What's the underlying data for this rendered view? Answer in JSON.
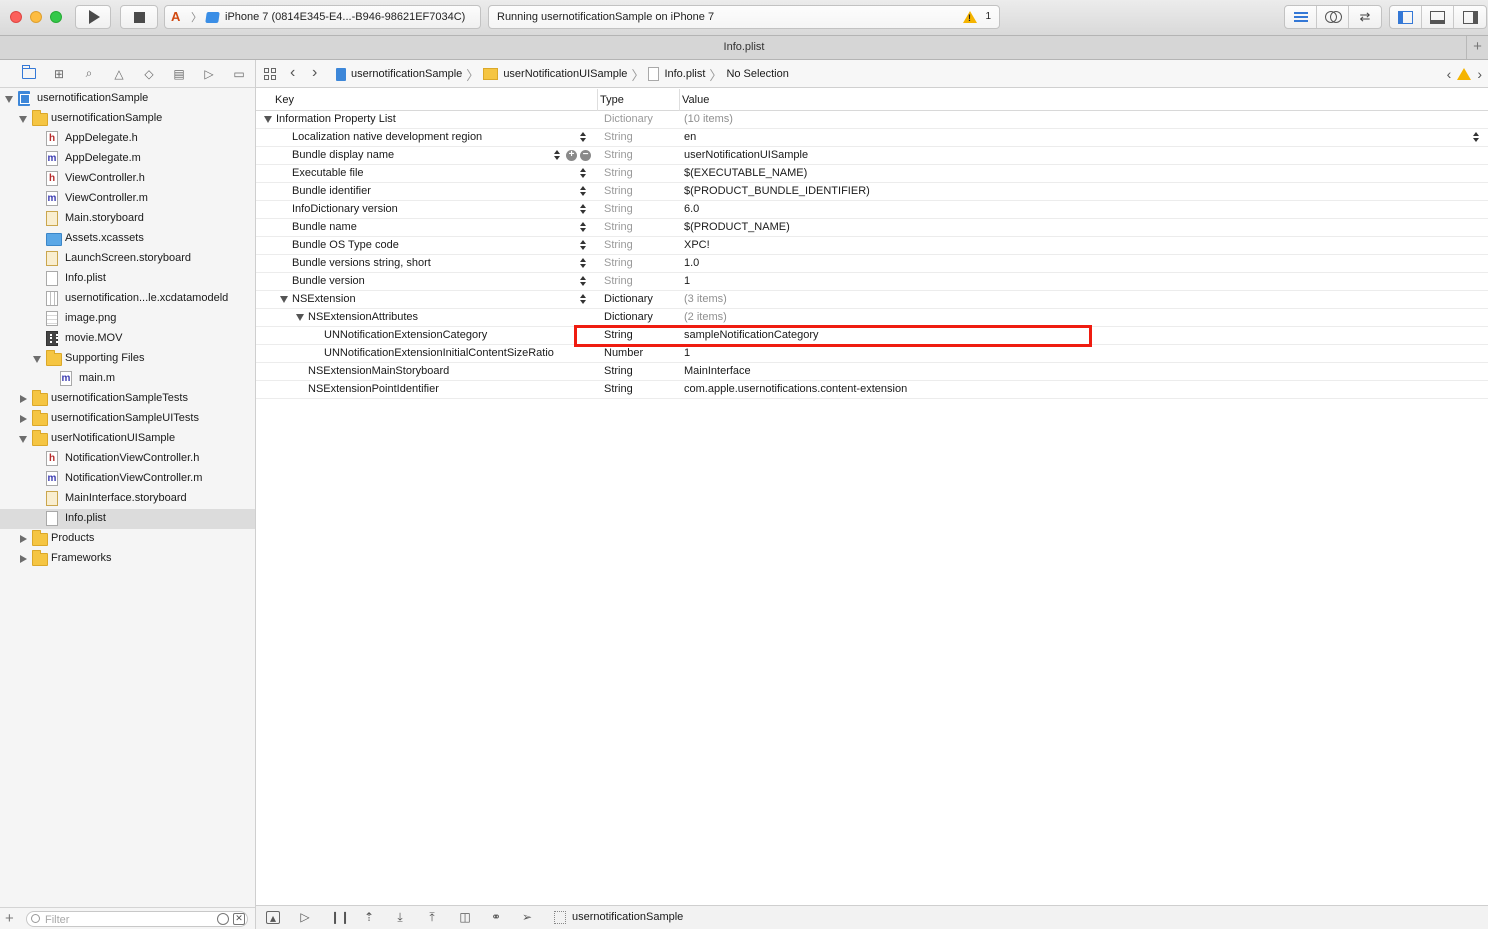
{
  "toolbar": {
    "scheme": "iPhone 7 (0814E345-E4...-B946-98621EF7034C)",
    "activity": "Running usernotificationSample on iPhone 7",
    "warning_count": "1"
  },
  "tab": {
    "title": "Info.plist"
  },
  "navigator": {
    "items": [
      {
        "label": "usernotificationSample",
        "icon": "project-icon",
        "state": "open"
      },
      {
        "label": "usernotificationSample",
        "icon": "folder-icon",
        "state": "open"
      },
      {
        "label": "AppDelegate.h",
        "icon": "header-file-icon",
        "glyph": "h"
      },
      {
        "label": "AppDelegate.m",
        "icon": "objc-file-icon",
        "glyph": "m"
      },
      {
        "label": "ViewController.h",
        "icon": "header-file-icon",
        "glyph": "h"
      },
      {
        "label": "ViewController.m",
        "icon": "objc-file-icon",
        "glyph": "m"
      },
      {
        "label": "Main.storyboard",
        "icon": "storyboard-file-icon"
      },
      {
        "label": "Assets.xcassets",
        "icon": "asset-catalog-icon"
      },
      {
        "label": "LaunchScreen.storyboard",
        "icon": "storyboard-file-icon"
      },
      {
        "label": "Info.plist",
        "icon": "plist-file-icon"
      },
      {
        "label": "usernotification...le.xcdatamodeld",
        "icon": "core-data-model-icon"
      },
      {
        "label": "image.png",
        "icon": "image-file-icon"
      },
      {
        "label": "movie.MOV",
        "icon": "movie-file-icon"
      },
      {
        "label": "Supporting Files",
        "icon": "folder-icon",
        "state": "open"
      },
      {
        "label": "main.m",
        "icon": "objc-file-icon",
        "glyph": "m"
      },
      {
        "label": "usernotificationSampleTests",
        "icon": "folder-icon",
        "state": "closed"
      },
      {
        "label": "usernotificationSampleUITests",
        "icon": "folder-icon",
        "state": "closed"
      },
      {
        "label": "userNotificationUISample",
        "icon": "folder-icon",
        "state": "open"
      },
      {
        "label": "NotificationViewController.h",
        "icon": "header-file-icon",
        "glyph": "h"
      },
      {
        "label": "NotificationViewController.m",
        "icon": "objc-file-icon",
        "glyph": "m"
      },
      {
        "label": "MainInterface.storyboard",
        "icon": "storyboard-file-icon"
      },
      {
        "label": "Info.plist",
        "icon": "plist-file-icon",
        "selected": true
      },
      {
        "label": "Products",
        "icon": "folder-icon",
        "state": "closed"
      },
      {
        "label": "Frameworks",
        "icon": "folder-icon",
        "state": "closed"
      }
    ],
    "filter_placeholder": "Filter"
  },
  "jumpbar": {
    "crumbs": [
      "usernotificationSample",
      "userNotificationUISample",
      "Info.plist",
      "No Selection"
    ]
  },
  "plist": {
    "columns": {
      "key": "Key",
      "type": "Type",
      "value": "Value"
    },
    "rows": [
      {
        "key": "Information Property List",
        "type": "Dictionary",
        "value": "(10 items)",
        "disclosure": true
      },
      {
        "key": "Localization native development region",
        "type": "String",
        "value": "en"
      },
      {
        "key": "Bundle display name",
        "type": "String",
        "value": "userNotificationUISample"
      },
      {
        "key": "Executable file",
        "type": "String",
        "value": "$(EXECUTABLE_NAME)"
      },
      {
        "key": "Bundle identifier",
        "type": "String",
        "value": "$(PRODUCT_BUNDLE_IDENTIFIER)"
      },
      {
        "key": "InfoDictionary version",
        "type": "String",
        "value": "6.0"
      },
      {
        "key": "Bundle name",
        "type": "String",
        "value": "$(PRODUCT_NAME)"
      },
      {
        "key": "Bundle OS Type code",
        "type": "String",
        "value": "XPC!"
      },
      {
        "key": "Bundle versions string, short",
        "type": "String",
        "value": "1.0"
      },
      {
        "key": "Bundle version",
        "type": "String",
        "value": "1"
      },
      {
        "key": "NSExtension",
        "type": "Dictionary",
        "value": "(3 items)",
        "disclosure": true
      },
      {
        "key": "NSExtensionAttributes",
        "type": "Dictionary",
        "value": "(2 items)",
        "disclosure": true
      },
      {
        "key": "UNNotificationExtensionCategory",
        "type": "String",
        "value": "sampleNotificationCategory",
        "highlighted": true
      },
      {
        "key": "UNNotificationExtensionInitialContentSizeRatio",
        "type": "Number",
        "value": "1"
      },
      {
        "key": "NSExtensionMainStoryboard",
        "type": "String",
        "value": "MainInterface"
      },
      {
        "key": "NSExtensionPointIdentifier",
        "type": "String",
        "value": "com.apple.usernotifications.content-extension"
      }
    ]
  },
  "debugbar": {
    "target": "usernotificationSample"
  },
  "colors": {
    "highlight": "#ef1c10",
    "accent": "#3478d6",
    "warning": "#f5b400"
  }
}
